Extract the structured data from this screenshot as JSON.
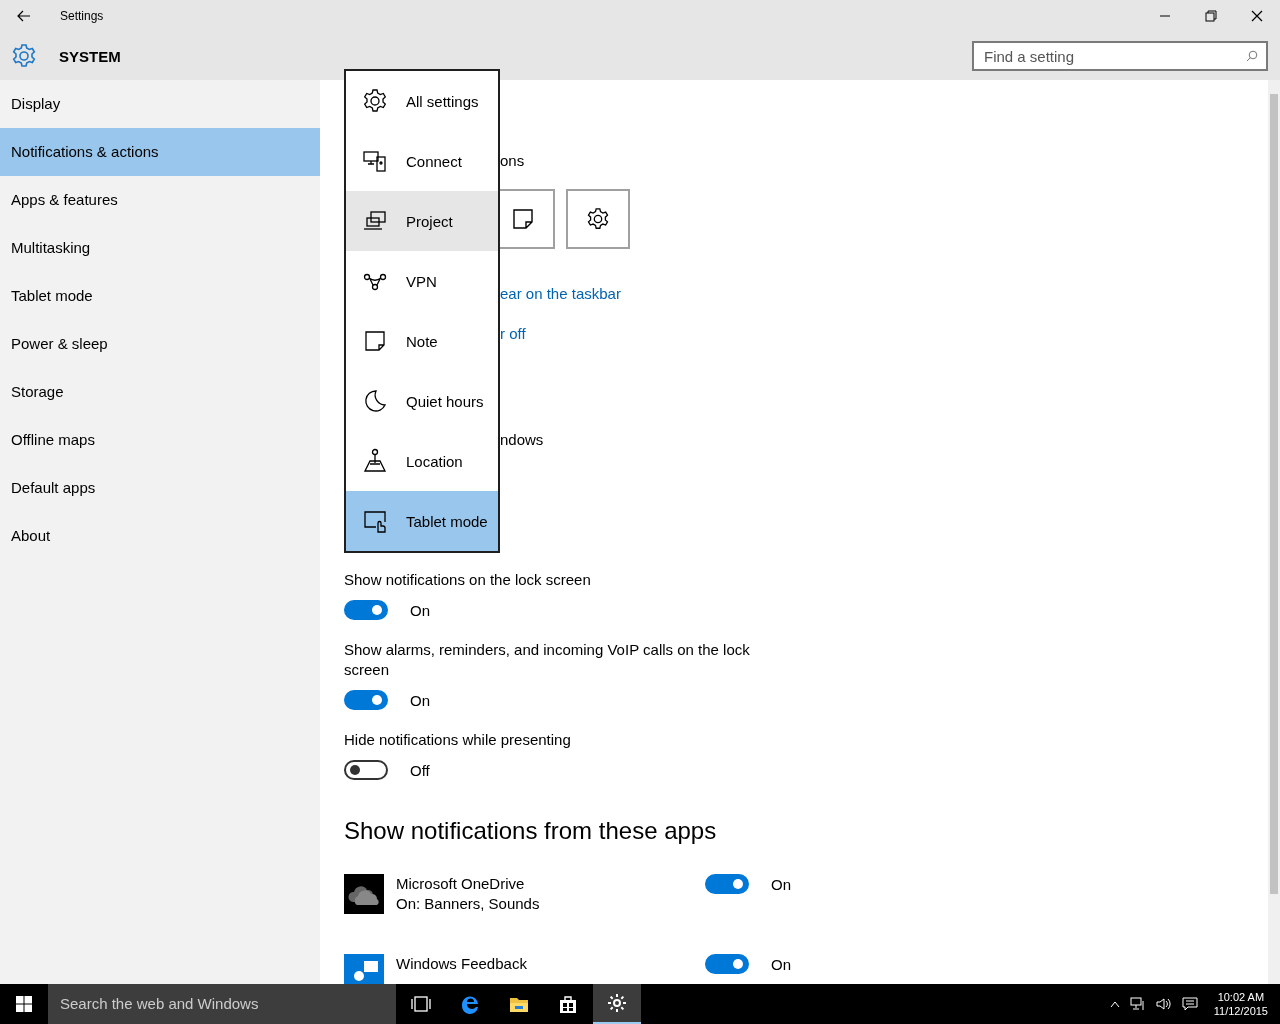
{
  "window": {
    "title": "Settings"
  },
  "header": {
    "title": "SYSTEM",
    "search": {
      "placeholder": "Find a setting"
    }
  },
  "sidebar": {
    "items": [
      {
        "label": "Display",
        "selected": false
      },
      {
        "label": "Notifications & actions",
        "selected": true
      },
      {
        "label": "Apps & features",
        "selected": false
      },
      {
        "label": "Multitasking",
        "selected": false
      },
      {
        "label": "Tablet mode",
        "selected": false
      },
      {
        "label": "Power & sleep",
        "selected": false
      },
      {
        "label": "Storage",
        "selected": false
      },
      {
        "label": "Offline maps",
        "selected": false
      },
      {
        "label": "Default apps",
        "selected": false
      },
      {
        "label": "About",
        "selected": false
      }
    ]
  },
  "content": {
    "partial_heading": "ons",
    "links": [
      "ear on the taskbar",
      "r off"
    ],
    "partial_label": "ndows",
    "toggles": [
      {
        "label": "Show notifications on the lock screen",
        "on": true,
        "state_text": "On"
      },
      {
        "label": "Show alarms, reminders, and incoming VoIP calls on the lock screen",
        "on": true,
        "state_text": "On"
      },
      {
        "label": "Hide notifications while presenting",
        "on": false,
        "state_text": "Off"
      }
    ],
    "apps_heading": "Show notifications from these apps",
    "apps": [
      {
        "name": "Microsoft OneDrive",
        "detail": "On: Banners, Sounds",
        "on": true,
        "state_text": "On"
      },
      {
        "name": "Windows Feedback",
        "on": true,
        "state_text": "On"
      }
    ]
  },
  "quick_actions_menu": {
    "items": [
      {
        "label": "All settings",
        "selected": false,
        "hovered": false
      },
      {
        "label": "Connect",
        "selected": false,
        "hovered": false
      },
      {
        "label": "Project",
        "selected": false,
        "hovered": true
      },
      {
        "label": "VPN",
        "selected": false,
        "hovered": false
      },
      {
        "label": "Note",
        "selected": false,
        "hovered": false
      },
      {
        "label": "Quiet hours",
        "selected": false,
        "hovered": false
      },
      {
        "label": "Location",
        "selected": false,
        "hovered": false
      },
      {
        "label": "Tablet mode",
        "selected": true,
        "hovered": false
      }
    ]
  },
  "taskbar": {
    "search_placeholder": "Search the web and Windows",
    "apps": [
      {
        "selected": false
      },
      {
        "selected": false
      },
      {
        "selected": false
      },
      {
        "selected": false
      },
      {
        "selected": true
      }
    ],
    "clock": {
      "time": "10:02 AM",
      "date": "11/12/2015"
    }
  }
}
